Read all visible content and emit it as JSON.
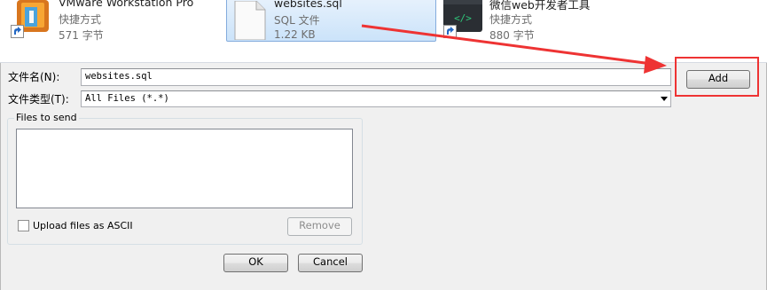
{
  "files": [
    {
      "name": "VMware Workstation Pro",
      "type": "快捷方式",
      "size": "571 字节",
      "icon": "vmware-icon"
    },
    {
      "name": "websites.sql",
      "type": "SQL 文件",
      "size": "1.22 KB",
      "icon": "document-icon"
    },
    {
      "name": "微信web开发者工具",
      "type": "快捷方式",
      "size": "880 字节",
      "icon": "code-editor-icon"
    }
  ],
  "form": {
    "filename_label": "文件名(N):",
    "filename_value": "websites.sql",
    "filetype_label": "文件类型(T):",
    "filetype_value": "All Files (*.*)"
  },
  "buttons": {
    "add": "Add",
    "remove": "Remove",
    "ok": "OK",
    "cancel": "Cancel"
  },
  "group": {
    "title": "Files to send",
    "ascii_label": "Upload files as ASCII",
    "ascii_checked": false
  },
  "colors": {
    "annotation": "#ee3333",
    "selection": "#cbe3fa"
  }
}
